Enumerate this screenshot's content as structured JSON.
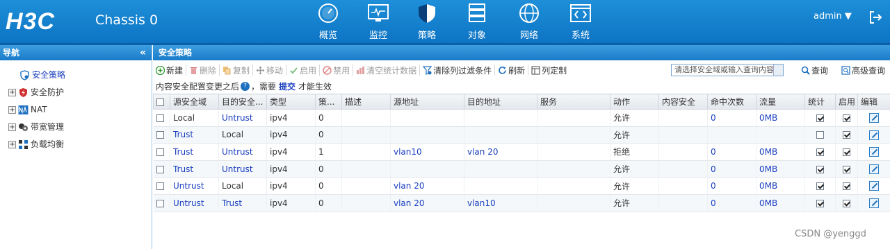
{
  "header": {
    "brand": "H3C",
    "device": "Chassis 0",
    "nav": [
      {
        "label": "概览",
        "icon": "gauge-icon"
      },
      {
        "label": "监控",
        "icon": "monitor-icon"
      },
      {
        "label": "策略",
        "icon": "shield-icon"
      },
      {
        "label": "对象",
        "icon": "server-icon"
      },
      {
        "label": "网络",
        "icon": "globe-icon"
      },
      {
        "label": "系统",
        "icon": "code-icon"
      }
    ],
    "user": "admin ▼",
    "colors": {
      "bar": "#1680d0",
      "active": "#0a5fa8"
    }
  },
  "sidebar": {
    "title": "导航",
    "collapse": "«",
    "items": [
      {
        "label": "安全策略",
        "icon": "policy-shield-icon",
        "selected": true
      },
      {
        "label": "安全防护",
        "icon": "protect-icon"
      },
      {
        "label": "NAT",
        "icon": "nat-icon"
      },
      {
        "label": "带宽管理",
        "icon": "bandwidth-icon"
      },
      {
        "label": "负载均衡",
        "icon": "loadbalance-icon"
      }
    ]
  },
  "main": {
    "title": "安全策略",
    "toolbar": {
      "new": "新建",
      "delete": "删除",
      "copy": "复制",
      "move": "移动",
      "enable": "启用",
      "disable": "禁用",
      "clear_stats": "清空统计数据",
      "clear_filter": "清除列过滤条件",
      "refresh": "刷新",
      "columns": "列定制",
      "search_placeholder": "请选择安全域或输入查询内容",
      "query": "查询",
      "advanced": "高级查询"
    },
    "notice": {
      "before": "内容安全配置变更之后",
      "mid": "，需要",
      "link": "提交",
      "after": "才能生效"
    },
    "columns": [
      "源安全域",
      "目的安全...",
      "类型",
      "策...",
      "描述",
      "源地址",
      "目的地址",
      "服务",
      "动作",
      "内容安全",
      "命中次数",
      "流量",
      "统计",
      "启用",
      "编辑"
    ],
    "rows": [
      {
        "src": "Local",
        "dst": "Untrust",
        "type": "ipv4",
        "id": "0",
        "desc": "",
        "srcaddr": "",
        "dstaddr": "",
        "svc": "",
        "action": "允许",
        "cs": "",
        "hits": "0",
        "traffic": "0MB",
        "stat": true,
        "enable": true
      },
      {
        "src": "Trust",
        "dst": "Local",
        "type": "ipv4",
        "id": "0",
        "desc": "",
        "srcaddr": "",
        "dstaddr": "",
        "svc": "",
        "action": "允许",
        "cs": "",
        "hits": "",
        "traffic": "",
        "stat": false,
        "enable": true
      },
      {
        "src": "Trust",
        "dst": "Untrust",
        "type": "ipv4",
        "id": "1",
        "desc": "",
        "srcaddr": "vlan10",
        "dstaddr": "vlan 20",
        "svc": "",
        "action": "拒绝",
        "cs": "",
        "hits": "0",
        "traffic": "0MB",
        "stat": true,
        "enable": true
      },
      {
        "src": "Trust",
        "dst": "Untrust",
        "type": "ipv4",
        "id": "0",
        "desc": "",
        "srcaddr": "",
        "dstaddr": "",
        "svc": "",
        "action": "允许",
        "cs": "",
        "hits": "0",
        "traffic": "0MB",
        "stat": true,
        "enable": true
      },
      {
        "src": "Untrust",
        "dst": "Local",
        "type": "ipv4",
        "id": "0",
        "desc": "",
        "srcaddr": "vlan 20",
        "dstaddr": "",
        "svc": "",
        "action": "允许",
        "cs": "",
        "hits": "0",
        "traffic": "0MB",
        "stat": true,
        "enable": true
      },
      {
        "src": "Untrust",
        "dst": "Trust",
        "type": "ipv4",
        "id": "0",
        "desc": "",
        "srcaddr": "vlan 20",
        "dstaddr": "vlan10",
        "svc": "",
        "action": "允许",
        "cs": "",
        "hits": "0",
        "traffic": "0MB",
        "stat": true,
        "enable": true
      }
    ]
  },
  "watermark": "CSDN @yenggd"
}
